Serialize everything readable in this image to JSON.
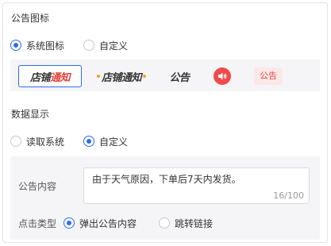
{
  "notice_icon_section": {
    "title": "公告图标",
    "options": [
      {
        "label": "系统图标",
        "selected": true
      },
      {
        "label": "自定义",
        "selected": false
      }
    ],
    "styles": [
      {
        "part_black": "店铺",
        "part_red": "通知"
      },
      {
        "text": "店铺通知"
      },
      {
        "text": "公告"
      },
      {
        "icon": "speaker-icon"
      },
      {
        "text": "公告"
      }
    ]
  },
  "data_display_section": {
    "title": "数据显示",
    "options": [
      {
        "label": "读取系统",
        "selected": false
      },
      {
        "label": "自定义",
        "selected": true
      }
    ],
    "content": {
      "label": "公告内容",
      "value": "由于天气原因，下单后7天内发货。",
      "counter": "16/100"
    },
    "click_type": {
      "label": "点击类型",
      "options": [
        {
          "label": "弹出公告内容",
          "selected": true
        },
        {
          "label": "跳转链接",
          "selected": false
        }
      ]
    }
  },
  "colors": {
    "accent": "#2f6bf0",
    "red": "#e8403a",
    "orange": "#f0a72a",
    "panel_bg": "#f5f5f8"
  }
}
